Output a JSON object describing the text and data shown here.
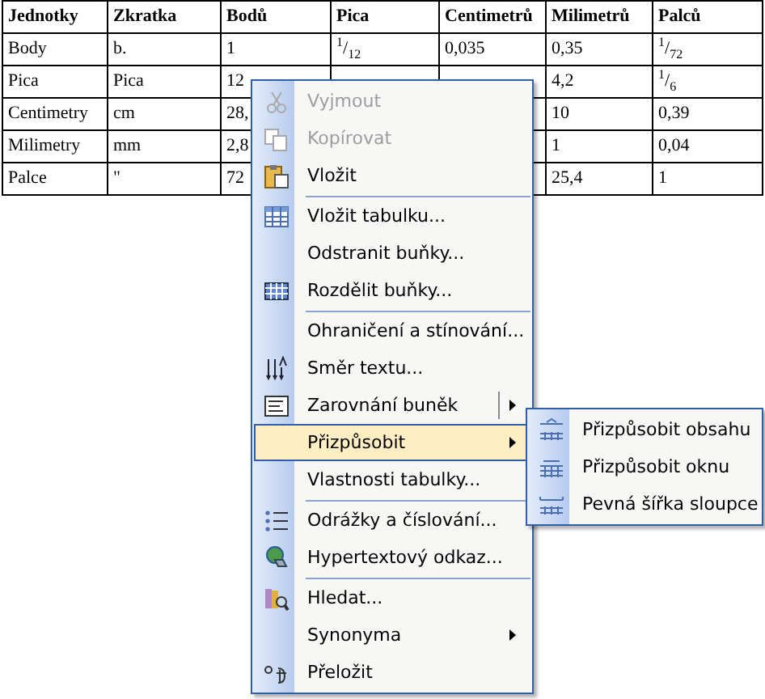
{
  "table": {
    "columns": [
      "Jednotky",
      "Zkratka",
      "Bodů",
      "Pica",
      "Centimetrů",
      "Milimetrů",
      "Palců"
    ],
    "rows": [
      [
        "Body",
        "b.",
        "1",
        "$^{1}$/$_{12}$",
        "0,035",
        "0,35",
        "$^{1}$/$_{72}$"
      ],
      [
        "Pica",
        "Pica",
        "12",
        null,
        null,
        "4,2",
        "$^{1}$/$_{6}$"
      ],
      [
        "Centimetry",
        "cm",
        "28,",
        null,
        null,
        "10",
        "0,39"
      ],
      [
        "Milimetry",
        "mm",
        "2,8",
        null,
        null,
        "1",
        "0,04"
      ],
      [
        "Palce",
        "\"",
        "72",
        null,
        null,
        "25,4",
        "1"
      ]
    ]
  },
  "context_menu": {
    "items": [
      {
        "kind": "item",
        "label": "Vyjmout",
        "disabled": true,
        "selected": false
      },
      {
        "kind": "item",
        "label": "Kopírovat",
        "disabled": true,
        "selected": false
      },
      {
        "kind": "item",
        "label": "Vložit",
        "disabled": false,
        "selected": false
      },
      {
        "kind": "separator"
      },
      {
        "kind": "item",
        "label": "Vložit tabulku...",
        "disabled": false,
        "selected": false
      },
      {
        "kind": "item",
        "label": "Odstranit buňky...",
        "disabled": false,
        "selected": false
      },
      {
        "kind": "item",
        "label": "Rozdělit buňky...",
        "disabled": false,
        "selected": false
      },
      {
        "kind": "separator"
      },
      {
        "kind": "item",
        "label": "Ohraničení a stínování...",
        "disabled": false,
        "selected": false
      },
      {
        "kind": "item",
        "label": "Směr textu...",
        "disabled": false,
        "selected": false
      },
      {
        "kind": "split",
        "label": "Zarovnání buněk",
        "disabled": false,
        "selected": false
      },
      {
        "kind": "submenu",
        "label": "Přizpůsobit",
        "disabled": false,
        "selected": true
      },
      {
        "kind": "item",
        "label": "Vlastnosti tabulky...",
        "disabled": false,
        "selected": false
      },
      {
        "kind": "separator"
      },
      {
        "kind": "item",
        "label": "Odrážky a číslování...",
        "disabled": false,
        "selected": false
      },
      {
        "kind": "item",
        "label": "Hypertextový odkaz...",
        "disabled": false,
        "selected": false
      },
      {
        "kind": "separator"
      },
      {
        "kind": "item",
        "label": "Hledat...",
        "disabled": false,
        "selected": false
      },
      {
        "kind": "submenu",
        "label": "Synonyma",
        "disabled": false,
        "selected": false
      },
      {
        "kind": "item",
        "label": "Přeložit",
        "disabled": false,
        "selected": false
      }
    ]
  },
  "submenu": {
    "items": [
      {
        "label": "Přizpůsobit obsahu"
      },
      {
        "label": "Přizpůsobit oknu"
      },
      {
        "label": "Pevná šířka sloupce"
      }
    ]
  }
}
